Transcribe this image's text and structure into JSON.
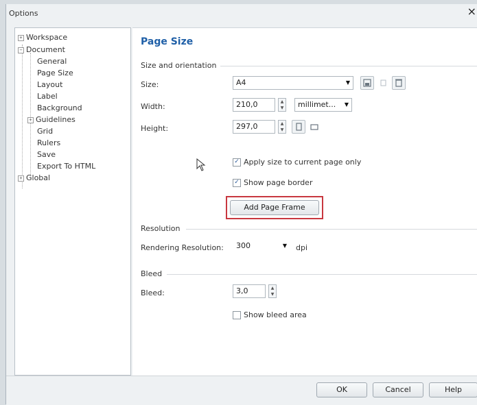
{
  "window": {
    "title": "Options",
    "close_glyph": "×"
  },
  "tree": {
    "items": [
      {
        "label": "Workspace",
        "expander": "+"
      },
      {
        "label": "Document",
        "expander": "−"
      },
      {
        "label": "General"
      },
      {
        "label": "Page Size"
      },
      {
        "label": "Layout"
      },
      {
        "label": "Label"
      },
      {
        "label": "Background"
      },
      {
        "label": "Guidelines",
        "expander": "+"
      },
      {
        "label": "Grid"
      },
      {
        "label": "Rulers"
      },
      {
        "label": "Save"
      },
      {
        "label": "Export To HTML"
      },
      {
        "label": "Global",
        "expander": "+"
      }
    ]
  },
  "page": {
    "title": "Page Size",
    "size_orientation": {
      "heading": "Size and orientation",
      "size_label": "Size:",
      "size_value": "A4",
      "width_label": "Width:",
      "width_value": "210,0",
      "units_value": "millimet...",
      "height_label": "Height:",
      "height_value": "297,0",
      "apply_current_label": "Apply size to current page only",
      "apply_current_checked": true,
      "show_border_label": "Show page border",
      "show_border_checked": true,
      "add_frame_label": "Add Page Frame"
    },
    "resolution": {
      "heading": "Resolution",
      "rendering_label": "Rendering Resolution:",
      "rendering_value": "300",
      "unit": "dpi"
    },
    "bleed": {
      "heading": "Bleed",
      "bleed_label": "Bleed:",
      "bleed_value": "3,0",
      "show_bleed_label": "Show bleed area",
      "show_bleed_checked": false
    }
  },
  "footer": {
    "ok_label": "OK",
    "cancel_label": "Cancel",
    "help_label": "Help"
  },
  "glyphs": {
    "check": "✓",
    "up": "▲",
    "down": "▼",
    "arrow": "▼"
  },
  "colors": {
    "accent": "#1f5fa7",
    "highlight": "#c8373f"
  }
}
